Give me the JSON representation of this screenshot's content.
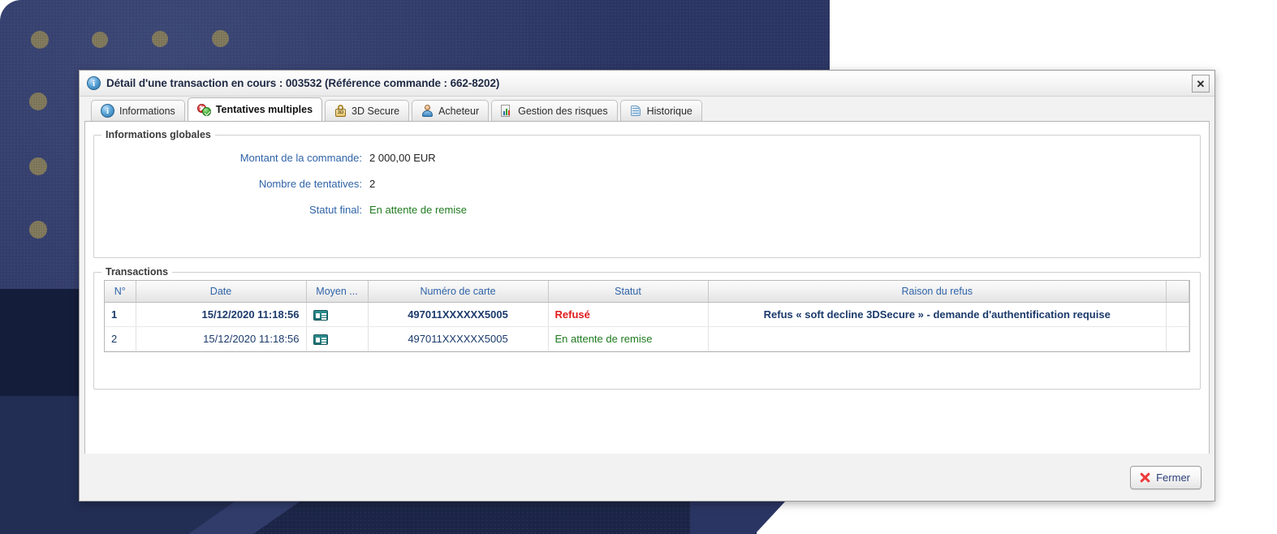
{
  "window": {
    "title": "Détail d'une transaction en cours : 003532 (Référence commande : 662-8202)",
    "info_icon": "info-icon",
    "close_glyph": "✕"
  },
  "tabs": [
    {
      "label": "Informations",
      "icon": "info-icon",
      "active": false
    },
    {
      "label": "Tentatives multiples",
      "icon": "multi-attempt-icon",
      "active": true
    },
    {
      "label": "3D Secure",
      "icon": "lock-3d-icon",
      "active": false
    },
    {
      "label": "Acheteur",
      "icon": "user-icon",
      "active": false
    },
    {
      "label": "Gestion des risques",
      "icon": "risk-chart-icon",
      "active": false
    },
    {
      "label": "Historique",
      "icon": "scroll-icon",
      "active": false
    }
  ],
  "global_info": {
    "legend": "Informations globales",
    "rows": [
      {
        "label": "Montant de la commande:",
        "value": "2 000,00 EUR",
        "green": false
      },
      {
        "label": "Nombre de tentatives:",
        "value": "2",
        "green": false
      },
      {
        "label": "Statut final:",
        "value": "En attente de remise",
        "green": true
      }
    ]
  },
  "transactions": {
    "legend": "Transactions",
    "columns": [
      "N°",
      "Date",
      "Moyen ...",
      "Numéro de carte",
      "Statut",
      "Raison du refus",
      ""
    ],
    "rows": [
      {
        "num": "1",
        "date": "15/12/2020 11:18:56",
        "moyen_icon": "credit-card-icon",
        "card": "497011XXXXXX5005",
        "statut": "Refusé",
        "statut_style": "refused",
        "reason": "Refus « soft decline 3DSecure » - demande d'authentification requise",
        "selected": true
      },
      {
        "num": "2",
        "date": "15/12/2020 11:18:56",
        "moyen_icon": "credit-card-icon",
        "card": "497011XXXXXX5005",
        "statut": "En attente de remise",
        "statut_style": "waiting",
        "reason": "",
        "selected": false
      }
    ]
  },
  "footer": {
    "close_button": "Fermer",
    "close_icon": "red-x-icon"
  },
  "colors": {
    "label_blue": "#2f63a8",
    "value_dark": "#222222",
    "status_green": "#1f7a1f",
    "status_red": "#e11b1b",
    "reason_navy": "#1b3a6b",
    "desktop_navy": "#2b3563",
    "desktop_dot": "#7b7356"
  }
}
